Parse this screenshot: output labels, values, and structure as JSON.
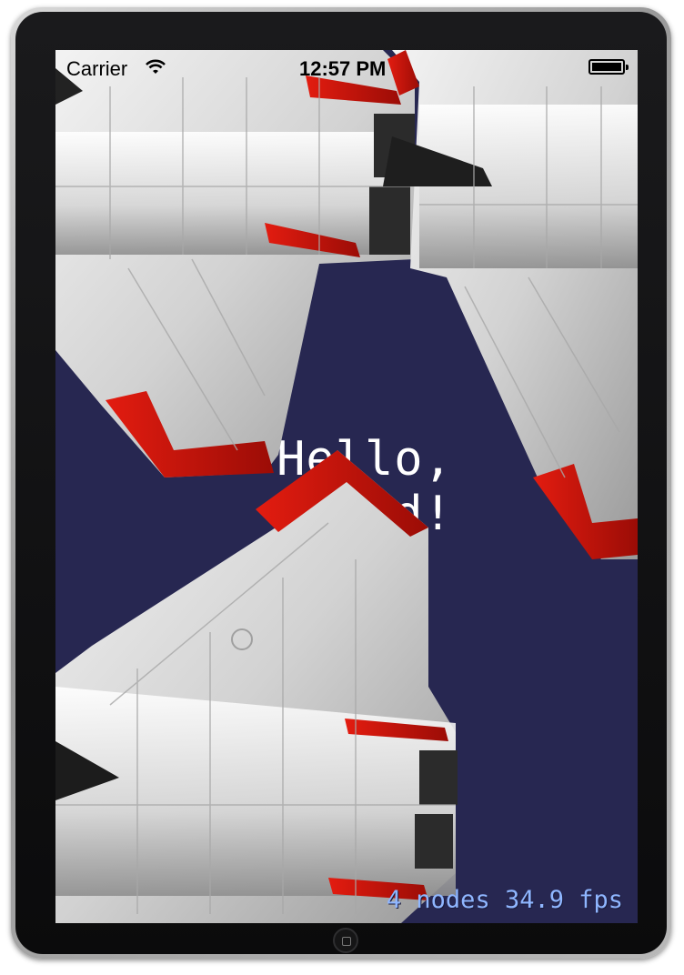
{
  "status_bar": {
    "carrier": "Carrier",
    "time": "12:57 PM"
  },
  "scene": {
    "label": "Hello, World!",
    "stats": "4 nodes 34.9 fps",
    "background": "#272751"
  },
  "icons": {
    "wifi": "wifi-icon",
    "battery": "battery-icon",
    "home": "home-button-icon"
  }
}
